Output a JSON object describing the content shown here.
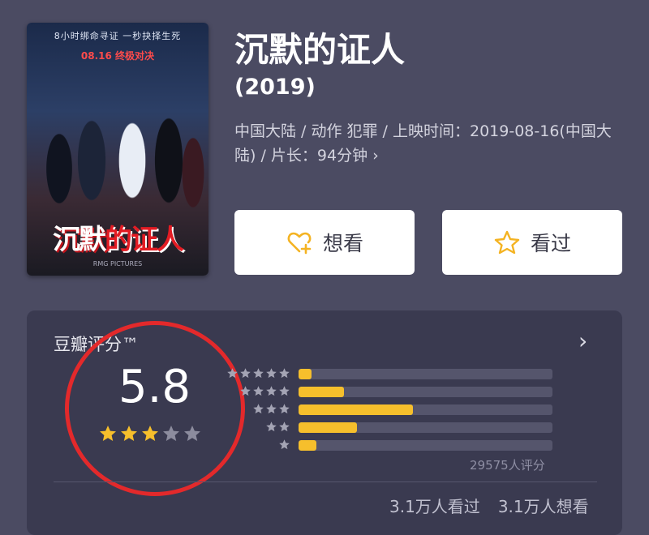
{
  "movie": {
    "title": "沉默的证人",
    "year": "(2019)",
    "meta": "中国大陆 / 动作 犯罪 / 上映时间：2019-08-16(中国大陆) / 片长：94分钟",
    "meta_chevron": "›",
    "poster": {
      "tagline": "8小时绑命寻证 一秒抉择生死",
      "date": "08.16 终极对决",
      "title_main": "沉默",
      "title_accent": "的证人",
      "credits": "RMG PICTURES"
    }
  },
  "actions": {
    "want_label": "想看",
    "seen_label": "看过"
  },
  "rating": {
    "header": "豆瓣评分™",
    "chevron": "›",
    "score": "5.8",
    "stars": [
      1,
      1,
      1,
      0,
      0
    ],
    "distribution": [
      {
        "stars": 5,
        "fraction": 0.05
      },
      {
        "stars": 4,
        "fraction": 0.18
      },
      {
        "stars": 3,
        "fraction": 0.45
      },
      {
        "stars": 2,
        "fraction": 0.23
      },
      {
        "stars": 1,
        "fraction": 0.07
      }
    ],
    "count": "29575人评分",
    "seen": "3.1万人看过",
    "want": "3.1万人想看"
  },
  "colors": {
    "background": "#4b4b62",
    "card": "#3a3a50",
    "accent_yellow": "#f6bf2c",
    "highlight_circle": "#e3292b"
  },
  "icons": {
    "want": "heart-plus-icon",
    "seen": "star-outline-icon",
    "chevron": "chevron-right-icon"
  }
}
